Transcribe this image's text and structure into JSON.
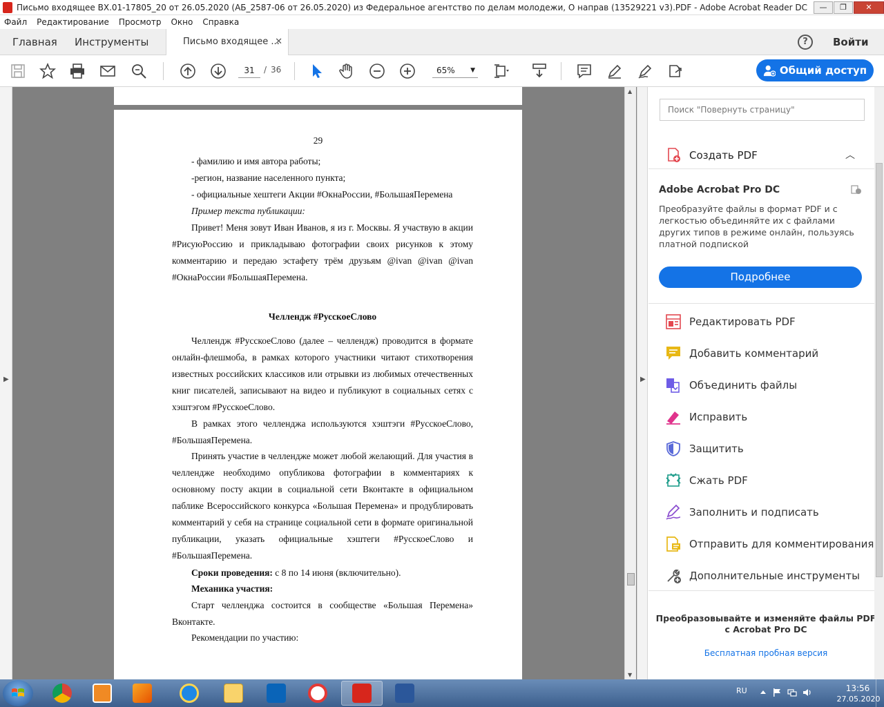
{
  "window": {
    "title": "Письмо входящее ВХ.01-17805_20 от 26.05.2020 (АБ_2587-06 от 26.05.2020) из Федеральное агентство по делам молодежи,  О направ (13529221 v3).PDF - Adobe Acrobat Reader DC",
    "minimize": "—",
    "maximize": "❐",
    "close": "✕"
  },
  "menu": [
    "Файл",
    "Редактирование",
    "Просмотр",
    "Окно",
    "Справка"
  ],
  "tabs": {
    "home": "Главная",
    "tools": "Инструменты",
    "document": "Письмо входящее ...",
    "close": "✕",
    "help": "?",
    "signin": "Войти"
  },
  "toolbar": {
    "page_current": "31",
    "page_sep": "/",
    "page_total": "36",
    "zoom": "65%",
    "share": "Общий доступ"
  },
  "document": {
    "page_number": "29",
    "lines": [
      "- фамилию и имя автора работы;",
      "-регион, название населенного пункта;",
      "- официальные хештеги Акции #ОкнаРоссии, #БольшаяПеремена",
      "Пример текста публикации:"
    ],
    "example_text": "Привет! Меня зовут Иван Иванов, я из г. Москвы. Я участвую в акции #РисуюРоссию и прикладываю фотографии своих рисунков к этому комментарию и передаю эстафету трём друзьям @ivan @ivan @ivan #ОкнаРоссии #БольшаяПеремена.",
    "heading": "Челлендж #РусскоеСлово",
    "para1": "Челлендж #РусскоеСлово (далее – челлендж) проводится в формате онлайн-флешмоба, в рамках которого участники читают стихотворения известных российских классиков или отрывки из любимых отечественных книг писателей, записывают на видео и публикуют в социальных сетях с хэштэгом #РусскоеСлово.",
    "para2": "В рамках этого челленджа используются хэштэги #РусскоеСлово, #БольшаяПеремена.",
    "para3": "Принять участие в челлендже может любой желающий. Для участия в челлендже необходимо опубликова фотографии в комментариях к основному посту акции в социальной сети Вконтакте в официальном паблике Всероссийского конкурса «Большая Перемена» и продублировать комментарий у себя на странице социальной сети в формате оригинальной публикации, указать официальные хэштеги #РусскоеСлово и #БольшаяПеремена.",
    "dates_label": "Сроки проведения:",
    "dates_value": " с 8 по 14 июня (включительно).",
    "mechanics_label": "Механика участия:",
    "para4": "Старт челленджа состоится в сообществе «Большая Перемена» Вконтакте.",
    "para5": "Рекомендации по участию:"
  },
  "panel": {
    "search_placeholder": "Поиск \"Повернуть страницу\"",
    "create_pdf": "Создать PDF",
    "promo_title": "Adobe Acrobat Pro DC",
    "promo_text": "Преобразуйте файлы в формат PDF и с легкостью объединяйте их с файлами других типов в режиме онлайн, пользуясь платной подпиской",
    "learn_more": "Подробнее",
    "tools": [
      {
        "label": "Редактировать PDF",
        "icon": "edit-pdf-icon",
        "color": "#e34850"
      },
      {
        "label": "Добавить комментарий",
        "icon": "comment-icon",
        "color": "#e8b815"
      },
      {
        "label": "Объединить файлы",
        "icon": "combine-files-icon",
        "color": "#6e5ce6"
      },
      {
        "label": "Исправить",
        "icon": "redact-icon",
        "color": "#e0338c"
      },
      {
        "label": "Защитить",
        "icon": "protect-icon",
        "color": "#5a6ad9"
      },
      {
        "label": "Сжать PDF",
        "icon": "compress-pdf-icon",
        "color": "#1d9c8a"
      },
      {
        "label": "Заполнить и подписать",
        "icon": "fill-sign-icon",
        "color": "#8a4ccf"
      },
      {
        "label": "Отправить для комментирования",
        "icon": "send-comment-icon",
        "color": "#e8b815"
      },
      {
        "label": "Дополнительные инструменты",
        "icon": "more-tools-icon",
        "color": "#555555"
      }
    ],
    "footer_text_1": "Преобразовывайте и изменяйте файлы PDF",
    "footer_text_2": "с Acrobat Pro DC",
    "trial_link": "Бесплатная пробная версия"
  },
  "taskbar": {
    "lang": "RU",
    "time": "13:56",
    "date": "27.05.2020",
    "apps": [
      "chrome-icon",
      "media-player-icon",
      "ftp-client-icon",
      "internet-explorer-icon",
      "file-explorer-icon",
      "outlook-icon",
      "yandex-browser-icon",
      "acrobat-icon",
      "word-icon"
    ]
  },
  "colors": {
    "accent": "#1473e6",
    "doc_background": "#808080"
  }
}
